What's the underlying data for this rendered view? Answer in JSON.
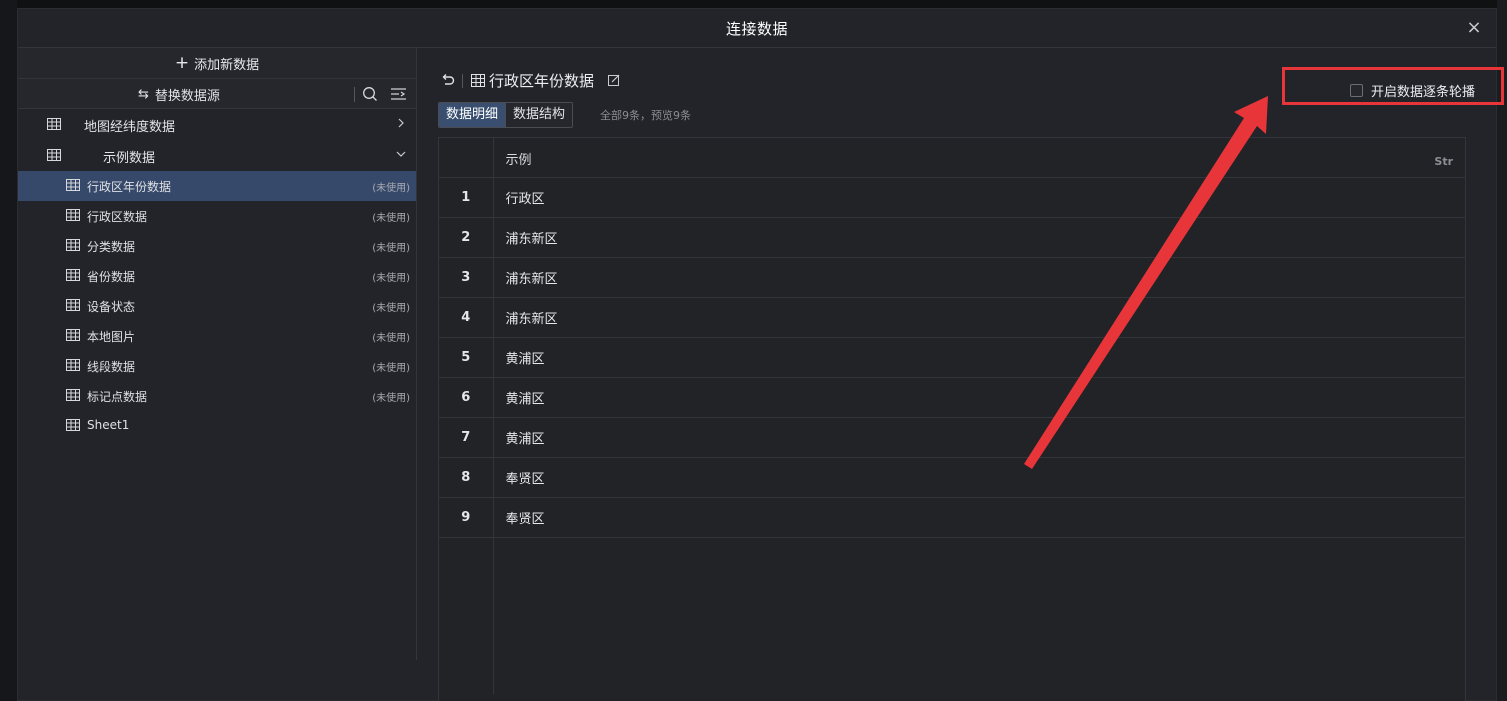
{
  "dialog": {
    "title": "连接数据",
    "close_glyph": "×"
  },
  "left": {
    "add_label": "添加新数据",
    "replace_label": "替换数据源",
    "folders": [
      {
        "label": "地图经纬度数据",
        "expanded": false
      },
      {
        "label": "示例数据",
        "expanded": true
      }
    ],
    "items": [
      {
        "label": "行政区年份数据",
        "status": "(未使用)",
        "active": true
      },
      {
        "label": "行政区数据",
        "status": "(未使用)"
      },
      {
        "label": "分类数据",
        "status": "(未使用)"
      },
      {
        "label": "省份数据",
        "status": "(未使用)"
      },
      {
        "label": "设备状态",
        "status": "(未使用)"
      },
      {
        "label": "本地图片",
        "status": "(未使用)"
      },
      {
        "label": "线段数据",
        "status": "(未使用)"
      },
      {
        "label": "标记点数据",
        "status": "(未使用)"
      },
      {
        "label": "Sheet1",
        "status": ""
      }
    ]
  },
  "right": {
    "dataset_title": "行政区年份数据",
    "tabs": [
      {
        "label": "数据明细",
        "active": true
      },
      {
        "label": "数据结构",
        "active": false
      }
    ],
    "count_text": "全部9条，预览9条",
    "carousel_label": "开启数据逐条轮播",
    "carousel_checked": false,
    "table": {
      "column": "示例",
      "column_type": "Str",
      "rows": [
        {
          "idx": "1",
          "value": "行政区"
        },
        {
          "idx": "2",
          "value": "浦东新区"
        },
        {
          "idx": "3",
          "value": "浦东新区"
        },
        {
          "idx": "4",
          "value": "浦东新区"
        },
        {
          "idx": "5",
          "value": "黄浦区"
        },
        {
          "idx": "6",
          "value": "黄浦区"
        },
        {
          "idx": "7",
          "value": "黄浦区"
        },
        {
          "idx": "8",
          "value": "奉贤区"
        },
        {
          "idx": "9",
          "value": "奉贤区"
        }
      ]
    }
  },
  "colors": {
    "accent_active": "#36496b",
    "annotation_red": "#e8353a"
  },
  "icons": {
    "add": "plus-icon",
    "replace": "swap-icon",
    "search": "search-icon",
    "filter": "filter-icon",
    "back": "undo-icon",
    "table": "table-grid-icon",
    "edit": "edit-icon",
    "close": "close-icon"
  }
}
